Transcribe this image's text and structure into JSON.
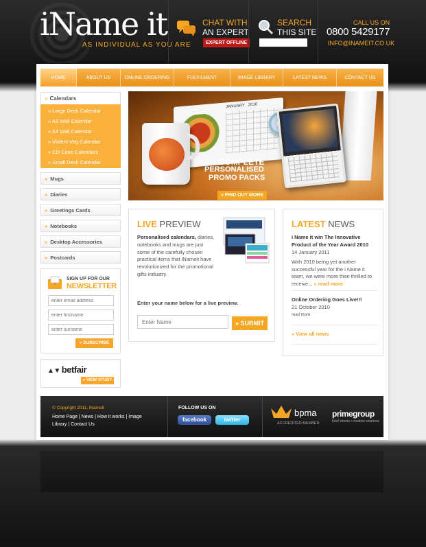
{
  "brand": {
    "logo": "iName it",
    "tagline": "AS INDIVIDUAL AS YOU ARE"
  },
  "header": {
    "chat": {
      "line1": "CHAT WITH",
      "line2": "AN EXPERT",
      "status": "EXPERT OFFLINE"
    },
    "search": {
      "line1": "SEARCH",
      "line2": "THIS SITE",
      "value": ""
    },
    "call": {
      "label": "CALL US ON",
      "phone": "0800 5429177",
      "email": "INFO@INAMEIT.CO.UK"
    }
  },
  "nav": [
    {
      "label": "HOME",
      "active": true
    },
    {
      "label": "ABOUT US",
      "active": false
    },
    {
      "label": "ONLINE ORDERING",
      "active": false
    },
    {
      "label": "FULFILMENT",
      "active": false
    },
    {
      "label": "IMAGE LIBRARY",
      "active": false
    },
    {
      "label": "LATEST NEWS",
      "active": false
    },
    {
      "label": "CONTACT US",
      "active": false
    }
  ],
  "sidebar": {
    "open_category": "Calendars",
    "sub_items": [
      "Large Desk Calendar",
      "A3 Wall Calendar",
      "A4 Wall Calendar",
      "Violent Veg Calendar",
      "CD Case Calendars",
      "Small Desk Calendar"
    ],
    "categories": [
      "Mugs",
      "Diaries",
      "Greetings Cards",
      "Notebooks",
      "Desktop Accessories",
      "Postcards"
    ]
  },
  "newsletter": {
    "title_line1": "SIGN UP FOR OUR",
    "title_line2": "NEWSLETTER",
    "email_placeholder": "enter email address",
    "firstname_placeholder": "enter firstname",
    "surname_placeholder": "enter surname",
    "button": "» SUBSCRIBE"
  },
  "sponsor": {
    "name": "betfair",
    "button": "» VIEW STUDY"
  },
  "banner": {
    "line1": "COMPLETE",
    "line2": "PERSONALISED",
    "line3": "PROMO PACKS",
    "button": "» FIND OUT MORE",
    "calendar_month": "JANUARY",
    "calendar_year": "2010"
  },
  "live_preview": {
    "title_accent": "LIVE",
    "title_rest": " PREVIEW",
    "body_bold": "Personalised calendars,",
    "body": " diaries, notebooks and mugs are just some of the carefully chosen practical items that iNameit have revolutionized for the promotional gifts industry.",
    "prompt": "Enter your name below for a live preview.",
    "name_placeholder": "Enter Name",
    "button": "» SUBMIT"
  },
  "news": {
    "title_accent": "LATEST",
    "title_rest": " NEWS",
    "items": [
      {
        "headline": "i Name it win The Innovative Product of the Year Award 2010",
        "date": "14 January 2011",
        "body": "With 2010 being yet another successful year for the i Name it team, we were more than thrilled to receive...",
        "more": " » read more"
      },
      {
        "headline": "Online Ordering Goes Live!!!",
        "date": "21 October 2010",
        "more": "read more"
      }
    ],
    "view_all": "» View all news"
  },
  "footer": {
    "copyright": "© Copyright 2011, iNameit",
    "links": "Home Page | News | How it works | Image Library | Contact Us",
    "follow": "FOLLOW US ON",
    "facebook": "facebook",
    "twitter": "twitter",
    "bpma": "bpma",
    "bpma_sub": "ACCREDITED MEMBER",
    "prime": "primegroup",
    "prime_sub": "brief sheets • creative solutions"
  }
}
